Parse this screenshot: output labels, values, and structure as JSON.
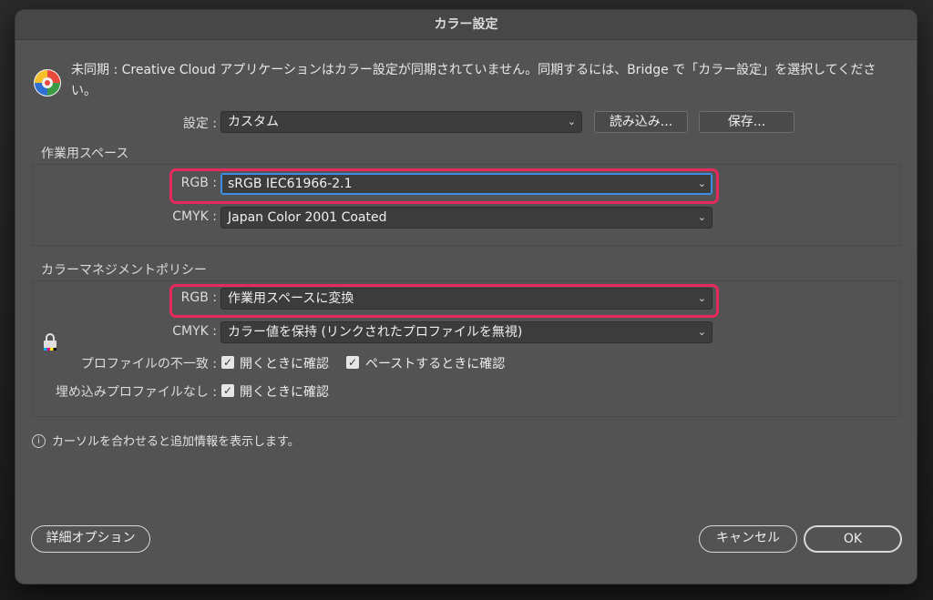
{
  "window": {
    "title": "カラー設定"
  },
  "sync": {
    "icon": "color-sync-icon",
    "message": "未同期 : Creative Cloud アプリケーションはカラー設定が同期されていません。同期するには、Bridge で「カラー設定」を選択してください。"
  },
  "settings": {
    "label": "設定 :",
    "value": "カスタム",
    "load_label": "読み込み...",
    "save_label": "保存..."
  },
  "working_spaces": {
    "title": "作業用スペース",
    "rgb_label": "RGB :",
    "rgb_value": "sRGB IEC61966-2.1",
    "cmyk_label": "CMYK :",
    "cmyk_value": "Japan Color 2001 Coated"
  },
  "policies": {
    "title": "カラーマネジメントポリシー",
    "rgb_label": "RGB :",
    "rgb_value": "作業用スペースに変換",
    "cmyk_label": "CMYK :",
    "cmyk_value": "カラー値を保持 (リンクされたプロファイルを無視)",
    "mismatch_label": "プロファイルの不一致 :",
    "mismatch_open": "開くときに確認",
    "mismatch_open_checked": true,
    "mismatch_paste": "ペーストするときに確認",
    "mismatch_paste_checked": true,
    "missing_label": "埋め込みプロファイルなし :",
    "missing_open": "開くときに確認",
    "missing_open_checked": true
  },
  "info": {
    "icon": "info-icon",
    "text": "カーソルを合わせると追加情報を表示します。"
  },
  "footer": {
    "advanced_label": "詳細オプション",
    "cancel_label": "キャンセル",
    "ok_label": "OK"
  },
  "colors": {
    "highlight": "#e8295c",
    "focus": "#3d8ee6",
    "dialog_bg": "#535353"
  }
}
